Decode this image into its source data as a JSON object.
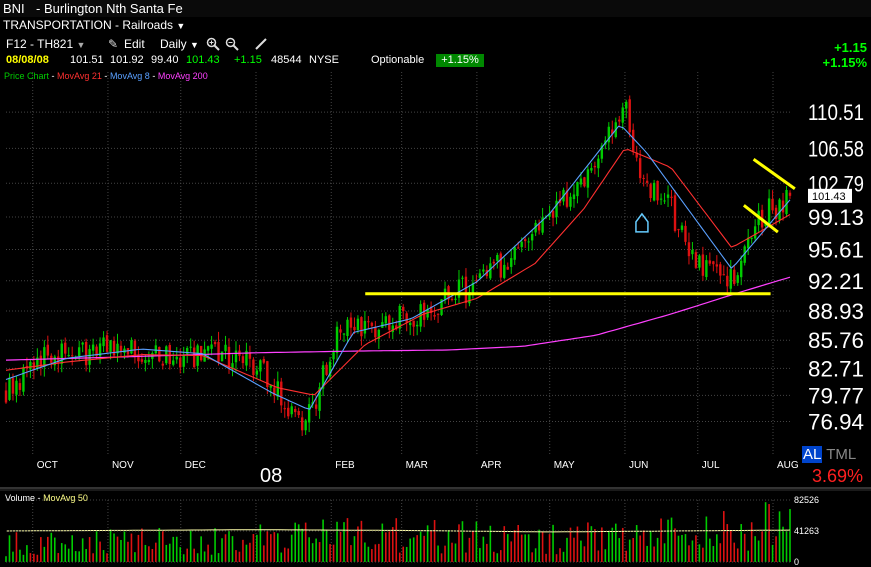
{
  "header": {
    "ticker": "BNI",
    "name": "- Burlington Nth Santa Fe",
    "sector": "TRANSPORTATION - Railroads",
    "sector_arrow": "▼",
    "toolbar": {
      "list": "F12 - TH821",
      "list_arrow": "▼",
      "edit": "Edit",
      "period": "Daily",
      "period_arrow": "▼",
      "zoom_in_icon": "zoom-in-icon",
      "zoom_out_icon": "zoom-out-icon",
      "pen_icon": "pen-icon"
    },
    "quote": {
      "date": "08/08/08",
      "open": "101.51",
      "high": "101.92",
      "low": "99.40",
      "close": "101.43",
      "change": "+1.15",
      "volume": "48544",
      "exchange": "NYSE",
      "optionable": "Optionable",
      "change_pct": "+1.15%"
    },
    "right_change": "+1.15",
    "right_change_pct": "+1.15%"
  },
  "legend": {
    "price_chart": "Price Chart",
    "ma21": "MovAvg 21",
    "ma8": "MovAvg 8",
    "ma200": "MovAvg 200",
    "sep": "-"
  },
  "altml": {
    "al": "AL",
    "tml": "TML",
    "value": "3.69%"
  },
  "volume_panel": {
    "label": "Volume",
    "ma_label": "MovAvg 50",
    "sep": "-",
    "ticks": [
      "82526",
      "41263",
      "0"
    ]
  },
  "colors": {
    "up": "#00cc00",
    "down": "#dd1111",
    "ma21": "#ff3030",
    "ma8": "#5aa0ff",
    "ma200": "#ff40ff",
    "trendline": "#ffff00",
    "grid": "#444444"
  },
  "chart_data": {
    "type": "candlestick",
    "x_labels": [
      "OCT",
      "NOV",
      "DEC",
      "08",
      "FEB",
      "MAR",
      "APR",
      "MAY",
      "JUN",
      "JUL",
      "AUG"
    ],
    "y_ticks": [
      110.51,
      106.58,
      102.79,
      99.13,
      95.61,
      92.21,
      88.93,
      85.76,
      82.71,
      79.77,
      76.94
    ],
    "ylim": [
      74.5,
      114.0
    ],
    "last_price_label": "101.43",
    "series": [
      {
        "name": "MovAvg 200",
        "x": [
          "2007-09-20",
          "2007-11-01",
          "2008-01-01",
          "2008-02-15",
          "2008-03-20",
          "2008-04-20",
          "2008-05-20",
          "2008-06-20",
          "2008-07-20",
          "2008-08-08"
        ],
        "values": [
          83.6,
          83.9,
          84.4,
          84.6,
          84.7,
          85.1,
          86.3,
          88.6,
          91.1,
          92.6
        ]
      },
      {
        "name": "MovAvg 21",
        "x": [
          "2007-09-20",
          "2007-10-15",
          "2007-11-15",
          "2007-12-10",
          "2008-01-10",
          "2008-01-25",
          "2008-02-15",
          "2008-03-10",
          "2008-04-01",
          "2008-04-25",
          "2008-05-15",
          "2008-06-01",
          "2008-06-20",
          "2008-07-15",
          "2008-08-08"
        ],
        "values": [
          82.5,
          83.4,
          84.2,
          84.1,
          80.6,
          79.8,
          85.3,
          88.6,
          90.3,
          94.1,
          100.0,
          106.6,
          104.5,
          95.8,
          99.4
        ]
      },
      {
        "name": "MovAvg 8",
        "x": [
          "2007-09-20",
          "2007-10-15",
          "2007-11-15",
          "2007-12-10",
          "2008-01-08",
          "2008-01-23",
          "2008-02-10",
          "2008-03-05",
          "2008-04-01",
          "2008-05-01",
          "2008-05-30",
          "2008-06-10",
          "2008-07-15",
          "2008-08-08"
        ],
        "values": [
          81.5,
          83.8,
          84.8,
          84.3,
          80.0,
          78.2,
          86.6,
          88.1,
          92.1,
          99.5,
          109.2,
          106.1,
          93.5,
          101.0
        ]
      },
      {
        "name": "Price",
        "x": [
          "2007-09-20",
          "2007-10-08",
          "2007-10-22",
          "2007-11-05",
          "2007-11-19",
          "2007-12-03",
          "2007-12-17",
          "2008-01-02",
          "2008-01-14",
          "2008-01-22",
          "2008-02-04",
          "2008-02-15",
          "2008-03-03",
          "2008-03-17",
          "2008-04-01",
          "2008-04-14",
          "2008-05-01",
          "2008-05-15",
          "2008-06-01",
          "2008-06-06",
          "2008-06-20",
          "2008-07-01",
          "2008-07-15",
          "2008-07-28",
          "2008-08-08"
        ],
        "values": [
          80.5,
          84.4,
          84.0,
          85.0,
          84.3,
          83.6,
          84.1,
          82.7,
          78.4,
          77.0,
          86.4,
          87.3,
          88.2,
          90.0,
          91.8,
          94.7,
          98.9,
          103.2,
          111.2,
          104.3,
          99.9,
          93.7,
          92.8,
          99.3,
          101.43
        ]
      },
      {
        "name": "Volume",
        "x": [
          "2007-09-20",
          "2007-11-01",
          "2008-01-01",
          "2008-02-15",
          "2008-04-01",
          "2008-05-15",
          "2008-06-15",
          "2008-07-15",
          "2008-08-08"
        ],
        "values": [
          22000,
          24000,
          28000,
          34000,
          30000,
          29000,
          36000,
          40000,
          48544
        ]
      },
      {
        "name": "MovAvg 50",
        "x": [
          "2007-09-20",
          "2008-01-01",
          "2008-03-01",
          "2008-05-01",
          "2008-07-01",
          "2008-08-08"
        ],
        "values": [
          41263,
          43000,
          42000,
          40000,
          41500,
          42500
        ]
      }
    ],
    "annotations": [
      {
        "type": "support-line",
        "x": [
          "2008-02-15",
          "2008-07-31"
        ],
        "values": [
          90.8,
          90.8
        ]
      },
      {
        "type": "channel-upper",
        "x": [
          "2008-07-24",
          "2008-08-10"
        ],
        "values": [
          105.4,
          102.2
        ]
      },
      {
        "type": "channel-lower",
        "x": [
          "2008-07-20",
          "2008-08-03"
        ],
        "values": [
          100.4,
          97.5
        ]
      }
    ],
    "grid": true,
    "legend": "top-left"
  }
}
